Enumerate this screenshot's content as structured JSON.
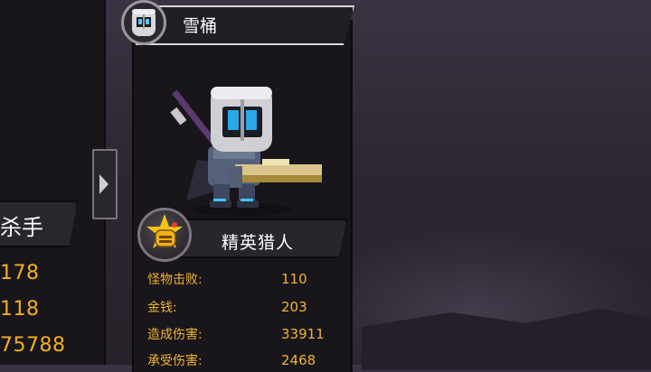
{
  "character": {
    "name": "雪桶",
    "rank_title": "精英猎人",
    "stats": [
      {
        "label": "怪物击败:",
        "value": "110"
      },
      {
        "label": "金钱:",
        "value": "203"
      },
      {
        "label": "造成伤害:",
        "value": "33911"
      },
      {
        "label": "承受伤害:",
        "value": "2468"
      }
    ]
  },
  "left_card": {
    "title_fragment": "杀手",
    "stats": [
      "178",
      "118",
      "75788"
    ]
  },
  "colors": {
    "stat_text": "#f0b530",
    "panel_bg": "#18151b",
    "background": "#2d2733"
  },
  "icons": {
    "avatar": "knight-helmet-icon",
    "rank_badge": "star-helmet-badge-icon",
    "nav_arrow": "chevron-right-icon"
  }
}
